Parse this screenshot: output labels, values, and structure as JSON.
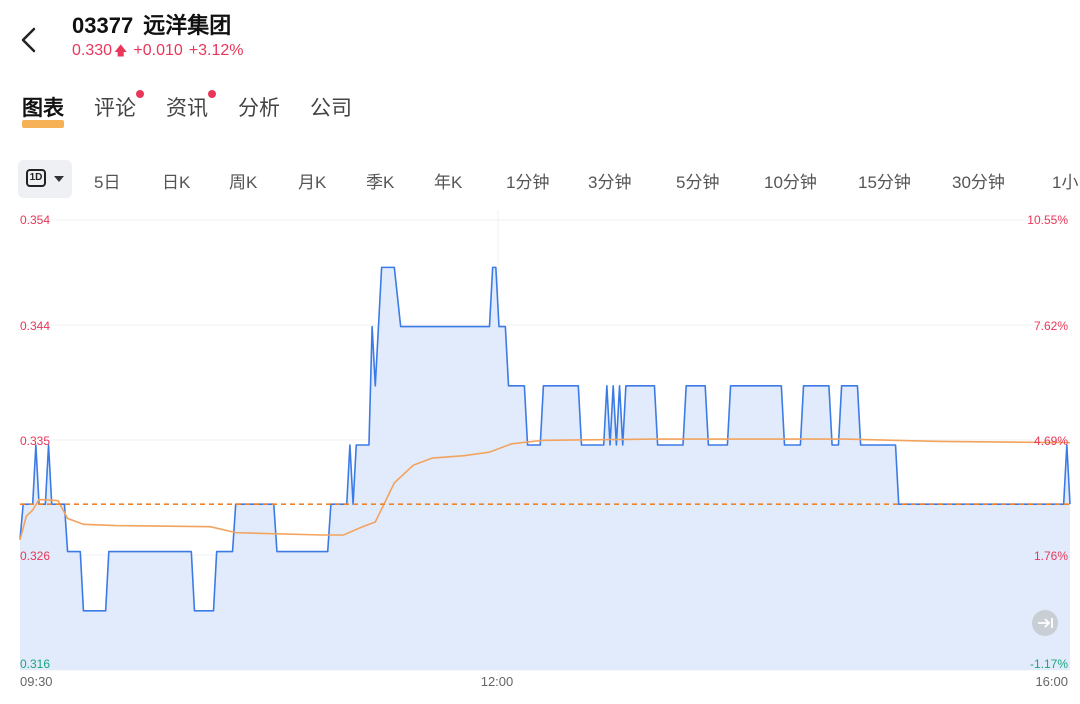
{
  "header": {
    "code": "03377",
    "name": "远洋集团",
    "price": "0.330",
    "change": "+0.010",
    "change_pct": "+3.12%"
  },
  "tabs": [
    {
      "label": "图表",
      "active": true,
      "dot": false
    },
    {
      "label": "评论",
      "active": false,
      "dot": true
    },
    {
      "label": "资讯",
      "active": false,
      "dot": true
    },
    {
      "label": "分析",
      "active": false,
      "dot": false
    },
    {
      "label": "公司",
      "active": false,
      "dot": false
    }
  ],
  "period_selector": {
    "label": "1D"
  },
  "periods": [
    "5日",
    "日K",
    "周K",
    "月K",
    "季K",
    "年K",
    "1分钟",
    "3分钟",
    "5分钟",
    "10分钟",
    "15分钟",
    "30分钟",
    "1小"
  ],
  "colors": {
    "up": "#e8375a",
    "down": "#1aa57d",
    "price_line": "#3c7be6",
    "area": "#e2ebfb",
    "avg_line": "#f2a35e",
    "prev_close": "#f0832a"
  },
  "chart_data": {
    "type": "line",
    "x_ticks": [
      "09:30",
      "12:00",
      "16:00"
    ],
    "y_left_ticks": [
      "0.354",
      "0.344",
      "0.335",
      "0.326",
      "0.316"
    ],
    "y_right_ticks": [
      "10.55%",
      "7.62%",
      "4.69%",
      "1.76%",
      "-1.17%"
    ],
    "ylim": [
      0.316,
      0.354
    ],
    "prev_close": 0.33,
    "series": [
      {
        "type": "price",
        "points": [
          [
            0,
            0.327
          ],
          [
            1,
            0.33
          ],
          [
            4,
            0.33
          ],
          [
            5,
            0.335
          ],
          [
            6,
            0.33
          ],
          [
            8,
            0.33
          ],
          [
            9,
            0.335
          ],
          [
            10,
            0.33
          ],
          [
            14,
            0.33
          ],
          [
            15,
            0.326
          ],
          [
            19,
            0.326
          ],
          [
            20,
            0.321
          ],
          [
            27,
            0.321
          ],
          [
            28,
            0.326
          ],
          [
            54,
            0.326
          ],
          [
            55,
            0.321
          ],
          [
            61,
            0.321
          ],
          [
            62,
            0.326
          ],
          [
            67,
            0.326
          ],
          [
            68,
            0.33
          ],
          [
            80,
            0.33
          ],
          [
            81,
            0.326
          ],
          [
            97,
            0.326
          ],
          [
            98,
            0.33
          ],
          [
            103,
            0.33
          ],
          [
            104,
            0.335
          ],
          [
            105,
            0.33
          ],
          [
            106,
            0.335
          ],
          [
            110,
            0.335
          ],
          [
            111,
            0.345
          ],
          [
            112,
            0.34
          ],
          [
            113,
            0.345
          ],
          [
            114,
            0.35
          ],
          [
            118,
            0.35
          ],
          [
            120,
            0.345
          ],
          [
            148,
            0.345
          ],
          [
            149,
            0.35
          ],
          [
            150,
            0.35
          ],
          [
            151,
            0.345
          ],
          [
            153,
            0.345
          ],
          [
            154,
            0.34
          ],
          [
            159,
            0.34
          ],
          [
            160,
            0.335
          ],
          [
            164,
            0.335
          ],
          [
            165,
            0.34
          ],
          [
            176,
            0.34
          ],
          [
            177,
            0.335
          ],
          [
            184,
            0.335
          ],
          [
            185,
            0.34
          ],
          [
            186,
            0.335
          ],
          [
            187,
            0.34
          ],
          [
            188,
            0.335
          ],
          [
            189,
            0.34
          ],
          [
            190,
            0.335
          ],
          [
            191,
            0.34
          ],
          [
            200,
            0.34
          ],
          [
            201,
            0.335
          ],
          [
            209,
            0.335
          ],
          [
            210,
            0.34
          ],
          [
            216,
            0.34
          ],
          [
            217,
            0.335
          ],
          [
            223,
            0.335
          ],
          [
            224,
            0.34
          ],
          [
            240,
            0.34
          ],
          [
            241,
            0.335
          ],
          [
            246,
            0.335
          ],
          [
            247,
            0.34
          ],
          [
            255,
            0.34
          ],
          [
            256,
            0.335
          ],
          [
            258,
            0.335
          ],
          [
            259,
            0.34
          ],
          [
            264,
            0.34
          ],
          [
            265,
            0.335
          ],
          [
            276,
            0.335
          ],
          [
            277,
            0.33
          ],
          [
            329,
            0.33
          ],
          [
            330,
            0.335
          ],
          [
            331,
            0.33
          ]
        ]
      },
      {
        "type": "average",
        "points": [
          [
            0,
            0.327
          ],
          [
            2,
            0.329
          ],
          [
            4,
            0.3295
          ],
          [
            6,
            0.3304
          ],
          [
            12,
            0.3303
          ],
          [
            15,
            0.3288
          ],
          [
            20,
            0.3283
          ],
          [
            30,
            0.3282
          ],
          [
            60,
            0.3281
          ],
          [
            68,
            0.3276
          ],
          [
            95,
            0.3274
          ],
          [
            102,
            0.3274
          ],
          [
            108,
            0.3281
          ],
          [
            112,
            0.3285
          ],
          [
            118,
            0.3318
          ],
          [
            124,
            0.3333
          ],
          [
            130,
            0.3339
          ],
          [
            140,
            0.3341
          ],
          [
            148,
            0.3344
          ],
          [
            155,
            0.3351
          ],
          [
            165,
            0.3354
          ],
          [
            200,
            0.3355
          ],
          [
            260,
            0.3355
          ],
          [
            290,
            0.3353
          ],
          [
            331,
            0.3352
          ]
        ]
      }
    ]
  }
}
